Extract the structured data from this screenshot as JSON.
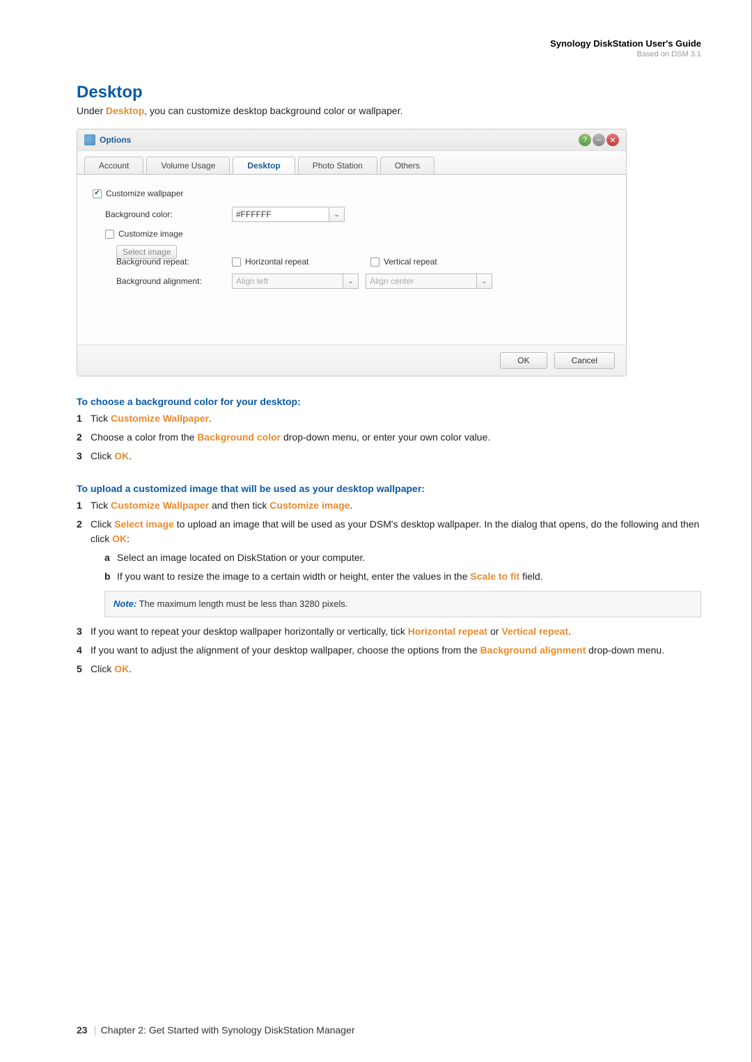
{
  "header": {
    "title": "Synology DiskStation User's Guide",
    "subtitle": "Based on DSM 3.1"
  },
  "section": {
    "title": "Desktop",
    "intro_pre": "Under ",
    "intro_kw": "Desktop",
    "intro_post": ", you can customize desktop background color or wallpaper."
  },
  "dialog": {
    "title": "Options",
    "tabs": {
      "account": "Account",
      "volume": "Volume Usage",
      "desktop": "Desktop",
      "photo": "Photo Station",
      "others": "Others"
    },
    "customize_wallpaper": "Customize wallpaper",
    "bg_color_label": "Background color:",
    "bg_color_value": "#FFFFFF",
    "customize_image": "Customize image",
    "select_image": "Select image",
    "bg_repeat_label": "Background repeat:",
    "h_repeat": "Horizontal repeat",
    "v_repeat": "Vertical repeat",
    "bg_align_label": "Background alignment:",
    "align_left": "Align left",
    "align_center": "Align center",
    "ok": "OK",
    "cancel": "Cancel"
  },
  "inst1": {
    "head": "To choose a background color for your desktop:",
    "s1a": "Tick ",
    "s1b": "Customize Wallpaper",
    "s1c": ".",
    "s2a": "Choose a color from the ",
    "s2b": "Background color",
    "s2c": " drop-down menu, or enter your own color value.",
    "s3a": "Click ",
    "s3b": "OK",
    "s3c": "."
  },
  "inst2": {
    "head": "To upload a customized image that will be used as your desktop wallpaper:",
    "s1a": "Tick ",
    "s1b": "Customize Wallpaper",
    "s1c": " and then tick ",
    "s1d": "Customize image",
    "s1e": ".",
    "s2a": "Click ",
    "s2b": "Select image",
    "s2c": " to upload an image that will be used as your DSM's desktop wallpaper. In the dialog that opens, do the following and then click ",
    "s2d": "OK",
    "s2e": ":",
    "s2suba": "Select an image located on DiskStation or your computer.",
    "s2subb_a": "If you want to resize the image to a certain width or height, enter the values in the ",
    "s2subb_b": "Scale to fit",
    "s2subb_c": " field.",
    "note_label": "Note:",
    "note_text": " The maximum length must be less than 3280 pixels.",
    "s3a": "If you want to repeat your desktop wallpaper horizontally or vertically, tick ",
    "s3b": "Horizontal repeat",
    "s3c": " or ",
    "s3d": "Vertical repeat",
    "s3e": ".",
    "s4a": "If you want to adjust the alignment of your desktop wallpaper, choose the options from the ",
    "s4b": "Background alignment",
    "s4c": " drop-down menu.",
    "s5a": "Click ",
    "s5b": "OK",
    "s5c": "."
  },
  "footer": {
    "page": "23",
    "chapter": "Chapter 2: Get Started with Synology DiskStation Manager"
  }
}
